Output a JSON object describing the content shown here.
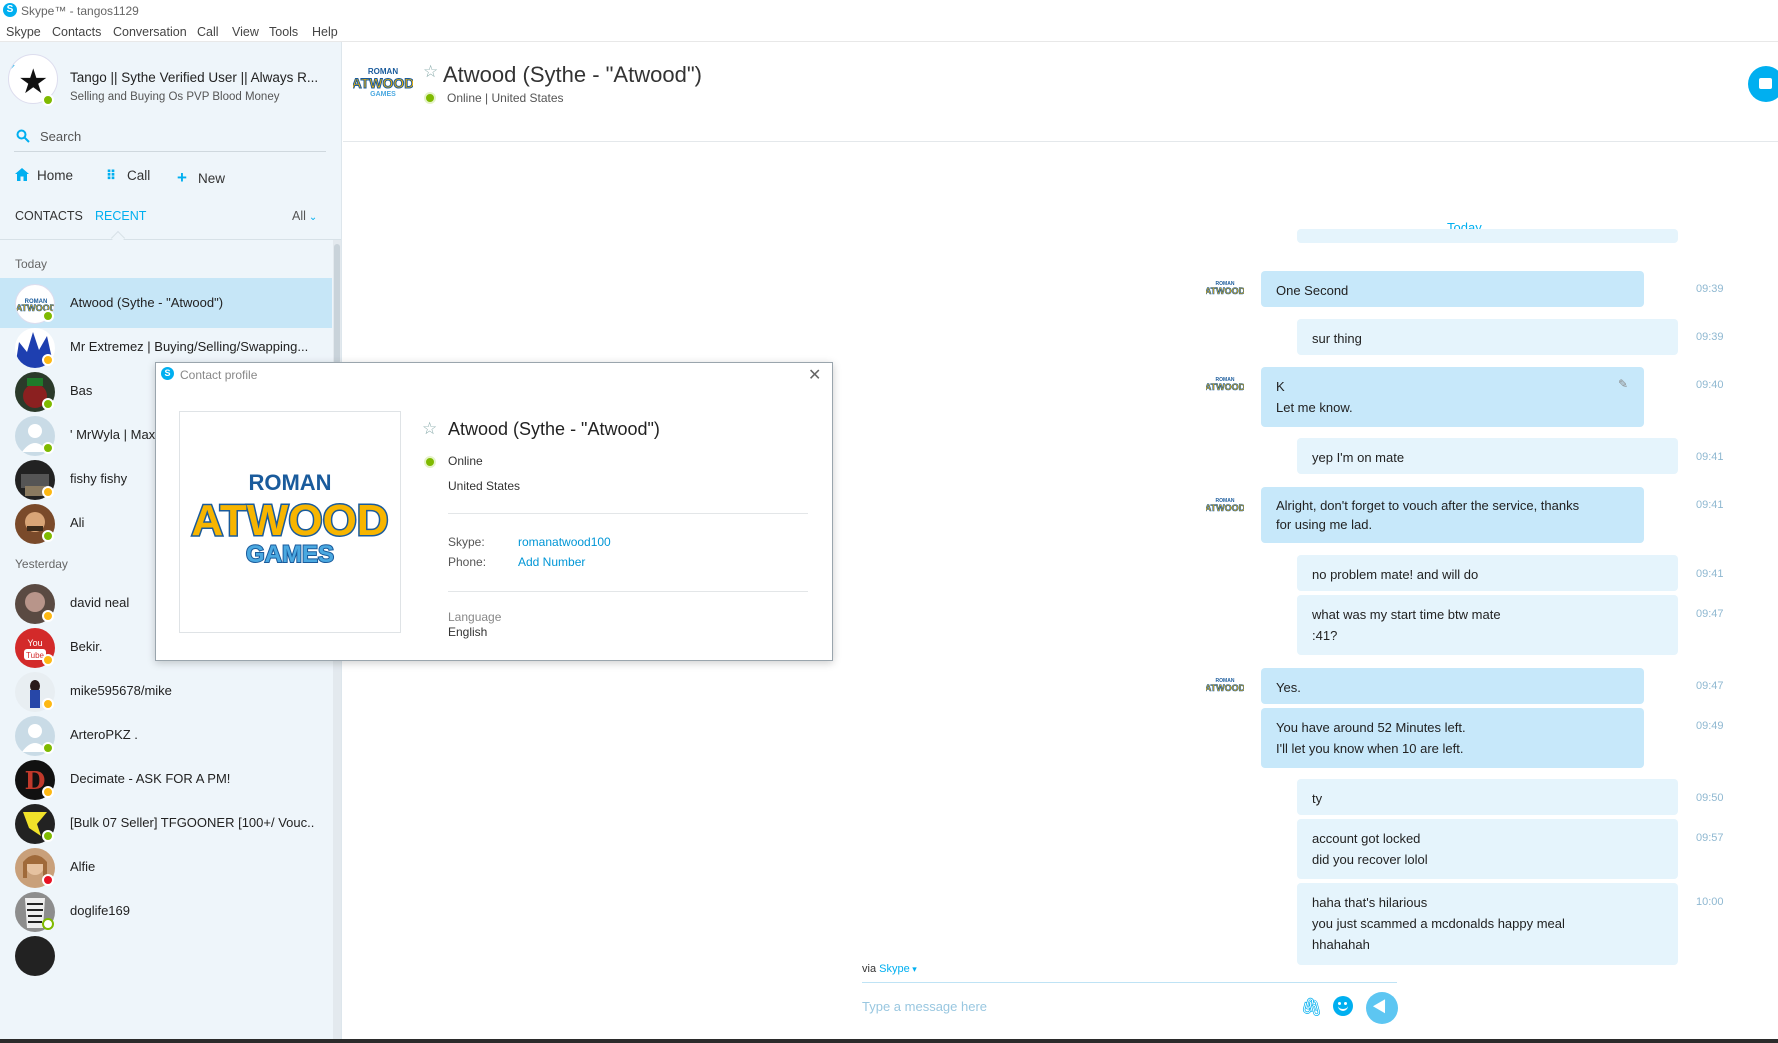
{
  "window": {
    "title": "Skype™ - tangos1129"
  },
  "menu": [
    "Skype",
    "Contacts",
    "Conversation",
    "Call",
    "View",
    "Tools",
    "Help"
  ],
  "profile": {
    "name": "Tango || Sythe Verified User || Always R...",
    "mood": "Selling and Buying Os PVP Blood Money"
  },
  "search": {
    "placeholder": "Search"
  },
  "nav": {
    "home": "Home",
    "call": "Call",
    "new": "New"
  },
  "tabs": {
    "contacts": "CONTACTS",
    "recent": "RECENT",
    "filter": "All"
  },
  "sections": {
    "today": "Today",
    "yesterday": "Yesterday"
  },
  "contacts": [
    {
      "name": "Atwood (Sythe - \"Atwood\")",
      "status": "online",
      "active": true
    },
    {
      "name": "Mr Extremez | Buying/Selling/Swapping...",
      "status": "away"
    },
    {
      "name": "Bas",
      "status": "online"
    },
    {
      "name": "' MrWyla | Max",
      "status": "online"
    },
    {
      "name": "fishy fishy",
      "status": "away"
    },
    {
      "name": "Ali",
      "status": "online"
    },
    {
      "name": "david neal",
      "status": "away"
    },
    {
      "name": "Bekir.",
      "status": "away"
    },
    {
      "name": "mike595678/mike",
      "status": "away"
    },
    {
      "name": "ArteroPKZ .",
      "status": "online"
    },
    {
      "name": "Decimate - ASK FOR A PM!",
      "status": "away"
    },
    {
      "name": "[Bulk 07 Seller] TFGOONER [100+/ Vouc...",
      "status": "online"
    },
    {
      "name": "Alfie",
      "status": "busy"
    },
    {
      "name": "doglife169",
      "status": "offline"
    }
  ],
  "chat": {
    "contact_name": "Atwood (Sythe - \"Atwood\")",
    "status_line": "Online  |  United States",
    "day_label": "Today",
    "messages": [
      {
        "from": "them",
        "lines": [
          "One Second"
        ],
        "time": "09:39"
      },
      {
        "from": "me",
        "lines": [
          "sur thing"
        ],
        "time": "09:39"
      },
      {
        "from": "them",
        "lines": [
          "K",
          "Let me know."
        ],
        "time": "09:40",
        "edited": true
      },
      {
        "from": "me",
        "lines": [
          "yep I'm on mate"
        ],
        "time": "09:41"
      },
      {
        "from": "them",
        "lines": [
          "Alright, don't forget to vouch after the service, thanks",
          "for using me lad."
        ],
        "time": "09:41"
      },
      {
        "from": "me",
        "lines": [
          "no problem mate! and will do"
        ],
        "time": "09:41"
      },
      {
        "from": "me",
        "lines": [
          "what was my start time btw mate",
          ":41?"
        ],
        "time": "09:47"
      },
      {
        "from": "them",
        "lines": [
          "Yes."
        ],
        "time": "09:47"
      },
      {
        "from": "them",
        "lines": [
          "You have around 52 Minutes left.",
          "I'll let you know when 10 are left."
        ],
        "time": "09:49"
      },
      {
        "from": "me",
        "lines": [
          "ty"
        ],
        "time": "09:50"
      },
      {
        "from": "me",
        "lines": [
          "account got locked",
          "did you recover lolol"
        ],
        "time": "09:57"
      },
      {
        "from": "me",
        "lines": [
          "haha that's hilarious",
          "you just scammed a mcdonalds happy meal",
          "hhahahah"
        ],
        "time": "10:00"
      }
    ],
    "via_prefix": "via",
    "via_service": "Skype",
    "compose_placeholder": "Type a message here"
  },
  "dialog": {
    "title": "Contact profile",
    "name": "Atwood (Sythe - \"Atwood\")",
    "status": "Online",
    "location": "United States",
    "skype_label": "Skype:",
    "skype_value": "romanatwood100",
    "phone_label": "Phone:",
    "phone_value": "Add Number",
    "language_label": "Language",
    "language_value": "English",
    "logo_top": "ROMAN",
    "logo_mid": "ATWOOD",
    "logo_bottom": "GAMES"
  },
  "colors": {
    "accent": "#00aff0",
    "online": "#7fba00",
    "away": "#fdb813",
    "busy": "#e81123",
    "bubble_them": "#c7e8fa",
    "bubble_me": "#e5f4fc",
    "sidebar_bg": "#eef5fa"
  },
  "icons": [
    "skype-logo-icon",
    "search-icon",
    "home-icon",
    "dialpad-icon",
    "plus-icon",
    "chevron-down-icon",
    "star-icon",
    "video-call-icon",
    "attach-icon",
    "emoticon-icon",
    "send-icon",
    "close-icon",
    "edit-icon"
  ]
}
